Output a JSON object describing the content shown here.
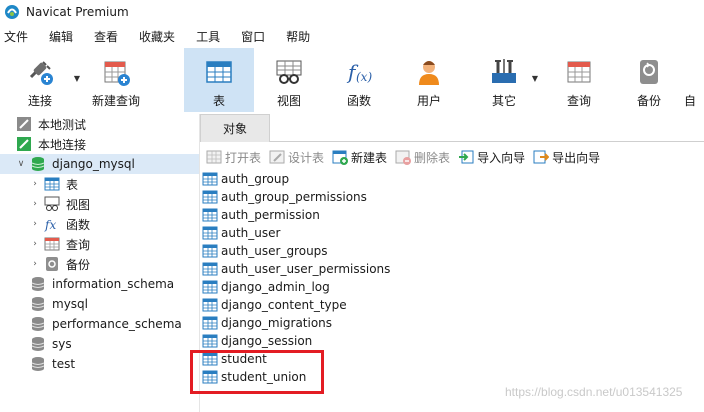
{
  "window": {
    "title": "Navicat Premium"
  },
  "menu": [
    "文件",
    "编辑",
    "查看",
    "收藏夹",
    "工具",
    "窗口",
    "帮助"
  ],
  "toolbar": {
    "connect": "连接",
    "new_query": "新建查询",
    "table": "表",
    "view": "视图",
    "function": "函数",
    "user": "用户",
    "other": "其它",
    "query": "查询",
    "backup": "备份",
    "overflow": "自"
  },
  "tree": {
    "local_test": "本地测试",
    "local_conn": "本地连接",
    "db": "django_mysql",
    "sub_table": "表",
    "sub_view": "视图",
    "sub_function": "函数",
    "sub_query": "查询",
    "sub_backup": "备份",
    "other_dbs": [
      "information_schema",
      "mysql",
      "performance_schema",
      "sys",
      "test"
    ]
  },
  "tab": {
    "objects": "对象"
  },
  "object_toolbar": {
    "open": "打开表",
    "design": "设计表",
    "new": "新建表",
    "delete": "删除表",
    "import": "导入向导",
    "export": "导出向导"
  },
  "tables": [
    "auth_group",
    "auth_group_permissions",
    "auth_permission",
    "auth_user",
    "auth_user_groups",
    "auth_user_user_permissions",
    "django_admin_log",
    "django_content_type",
    "django_migrations",
    "django_session",
    "student",
    "student_union"
  ],
  "watermark": "https://blog.csdn.net/u013541325",
  "colors": {
    "active_tool_bg": "#cfe3f5",
    "selected_row_bg": "#dbe9f7",
    "highlight_border": "#e31c23",
    "db_green": "#2fa84f"
  }
}
